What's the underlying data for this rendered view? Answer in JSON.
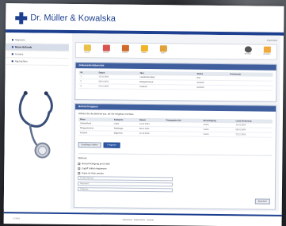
{
  "brand": {
    "title": "Dr. Müller & Kowalska",
    "accent": "#1c3f8f"
  },
  "sidebar": {
    "items": [
      {
        "label": "Startseite",
        "active": false
      },
      {
        "label": "Meine Befunde",
        "active": true
      },
      {
        "label": "Termine",
        "active": false
      },
      {
        "label": "Nachrichten",
        "active": false
      }
    ]
  },
  "header": {
    "user": "Angemeldet"
  },
  "toolbar": {
    "buttons": [
      {
        "label": "Upload",
        "icon": "upload-icon",
        "color": "#e8c04a"
      },
      {
        "label": "Löschen",
        "icon": "delete-icon",
        "color": "#d9534f"
      },
      {
        "label": "Drucken",
        "icon": "print-icon",
        "color": "#d06a2c"
      },
      {
        "label": "Ordner",
        "icon": "folder-icon",
        "color": "#f0b429"
      },
      {
        "label": "Archiv",
        "icon": "archive-icon",
        "color": "#e2a23b"
      },
      {
        "label": "Benutzer",
        "icon": "user-icon",
        "color": "#555555"
      },
      {
        "label": "Abmelden",
        "icon": "logout-icon",
        "color": "#f2a93b"
      }
    ]
  },
  "panel_documents": {
    "title": "Dokumentenübersicht",
    "columns": [
      "Nr.",
      "Datum",
      "Titel",
      "Status",
      "Kommentar"
    ],
    "rows": [
      [
        "1",
        "12.01.2024",
        "Laborbefund Blut",
        "Neu",
        ""
      ],
      [
        "2",
        "08.01.2024",
        "Röntgenbefund",
        "Gelesen",
        ""
      ],
      [
        "3",
        "22.12.2023",
        "Arztbrief",
        "Gelesen",
        ""
      ]
    ]
  },
  "panel_share": {
    "title": "Befund freigeben",
    "intro": "Wählen Sie die Befunde aus, die Sie freigeben möchten:",
    "columns": [
      "Name",
      "Kategorie",
      "Datum",
      "Freigegeben bis",
      "Berechtigung",
      "Letzte Änderung"
    ],
    "rows": [
      [
        "Laborbefund",
        "Labor",
        "12.01.2024",
        "",
        "Lesen",
        "12.01.2024"
      ],
      [
        "Röntgenbefund",
        "Radiologie",
        "08.01.2024",
        "",
        "Lesen",
        "08.01.2024"
      ],
      [
        "Arztbrief",
        "Allgemein",
        "22.12.2023",
        "",
        "Lesen",
        "22.12.2023"
      ]
    ],
    "recipient_button": "Empfänger wählen",
    "share_button": "Freigeben",
    "options_title": "Optionen",
    "options": [
      "Benachrichtigung per E-Mail",
      "Zugriff zeitlich begrenzen",
      "Kopie an mich senden"
    ],
    "field_placeholders": [
      "E-Mail-Adresse",
      "Nachricht",
      "Gültig bis"
    ],
    "save_button": "Speichern"
  },
  "footer": {
    "left": "© 2024",
    "right": "Impressum · Datenschutz · Kontakt"
  }
}
